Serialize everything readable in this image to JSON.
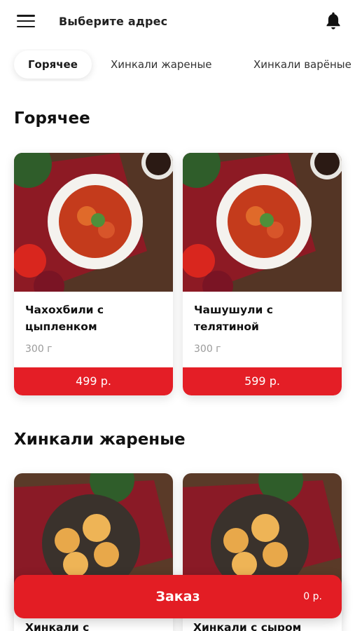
{
  "header": {
    "address_label": "Выберите адрес",
    "icons": [
      "menu-icon",
      "bell-icon"
    ]
  },
  "tabs": [
    {
      "label": "Горячее",
      "active": true
    },
    {
      "label": "Хинкали жареные",
      "active": false
    },
    {
      "label": "Хинкали варёные",
      "active": false
    }
  ],
  "sections": [
    {
      "title": "Горячее",
      "products": [
        {
          "name": "Чахохбили с цыпленком",
          "weight": "300 г",
          "price": "499 р."
        },
        {
          "name": "Чашушули с телятиной",
          "weight": "300 г",
          "price": "599 р."
        }
      ]
    },
    {
      "title": "Хинкали жареные",
      "products": [
        {
          "name": "Хинкали с"
        },
        {
          "name": "Хинкали с сыром"
        }
      ]
    }
  ],
  "order": {
    "label": "Заказ",
    "total": "0 р."
  },
  "colors": {
    "accent": "#e41e26",
    "text": "#111111",
    "muted": "#9a9a9a"
  }
}
